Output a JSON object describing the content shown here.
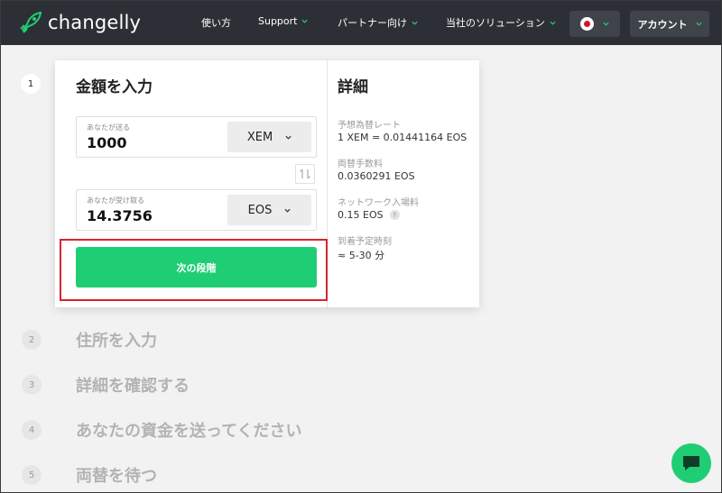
{
  "header": {
    "logo_text": "changelly",
    "nav": [
      {
        "label": "使い方",
        "has_dropdown": false
      },
      {
        "label": "Support",
        "has_dropdown": true
      },
      {
        "label": "パートナー向け",
        "has_dropdown": true
      },
      {
        "label": "当社のソリューション",
        "has_dropdown": true
      }
    ],
    "language_flag": "japan-flag-icon",
    "account_label": "アカウント"
  },
  "steps": [
    {
      "number": "1",
      "title": "金額を入力"
    },
    {
      "number": "2",
      "title": "住所を入力"
    },
    {
      "number": "3",
      "title": "詳細を確認する"
    },
    {
      "number": "4",
      "title": "あなたの資金を送ってください"
    },
    {
      "number": "5",
      "title": "両替を待つ"
    }
  ],
  "exchange": {
    "send_label": "あなたが送る",
    "send_amount": "1000",
    "send_currency": "XEM",
    "receive_label": "あなたが受け取る",
    "receive_amount": "14.3756",
    "receive_currency": "EOS",
    "next_label": "次の段階"
  },
  "details": {
    "title": "詳細",
    "rate_label": "予想為替レート",
    "rate_value": "1 XEM = 0.01441164 EOS",
    "fee_label": "両替手数料",
    "fee_value": "0.0360291 EOS",
    "network_label": "ネットワーク入場料",
    "network_value": "0.15 EOS",
    "network_help": "?",
    "eta_label": "到着予定時刻",
    "eta_value": "≈ 5-30 分"
  },
  "colors": {
    "header_bg": "#2c3036",
    "accent_green": "#1fce74",
    "highlight_red": "#d9232d"
  }
}
